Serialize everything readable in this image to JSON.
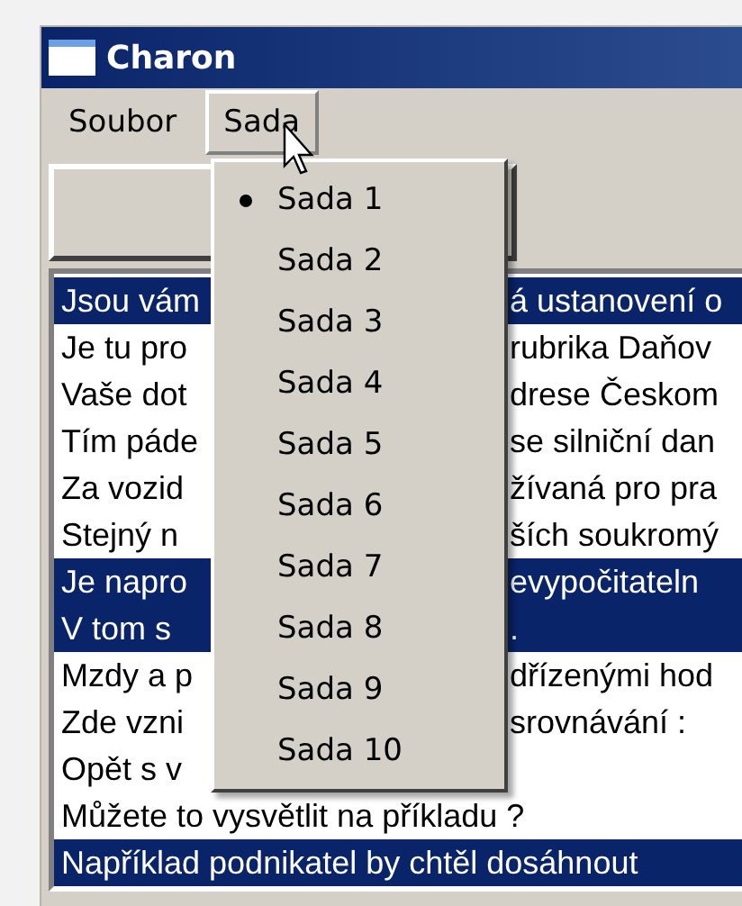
{
  "window": {
    "title": "Charon"
  },
  "menu_bar": [
    {
      "label": "Soubor",
      "selected": false
    },
    {
      "label": "Sada",
      "selected": true
    }
  ],
  "dropdown": [
    {
      "label": "Sada 1",
      "checked": true
    },
    {
      "label": "Sada 2",
      "checked": false
    },
    {
      "label": "Sada 3",
      "checked": false
    },
    {
      "label": "Sada 4",
      "checked": false
    },
    {
      "label": "Sada 5",
      "checked": false
    },
    {
      "label": "Sada 6",
      "checked": false
    },
    {
      "label": "Sada 7",
      "checked": false
    },
    {
      "label": "Sada 8",
      "checked": false
    },
    {
      "label": "Sada 9",
      "checked": false
    },
    {
      "label": "Sada 10",
      "checked": false
    }
  ],
  "list": [
    {
      "left": "Jsou vám",
      "right": "á ustanovení o",
      "selected": true
    },
    {
      "left": "Je tu pro",
      "right": "rubrika Daňov",
      "selected": false
    },
    {
      "left": "Vaše dot",
      "right": "drese Českom",
      "selected": false
    },
    {
      "left": "Tím páde",
      "right": "se silniční dan",
      "selected": false
    },
    {
      "left": "Za vozid",
      "right": "žívaná pro pra",
      "selected": false
    },
    {
      "left": "Stejný n",
      "right": "ších soukromý",
      "selected": false
    },
    {
      "left": "Je napro",
      "right": "evypočitateln",
      "selected": true
    },
    {
      "left": "V tom s",
      "right": ".",
      "selected": true
    },
    {
      "left": "Mzdy a p",
      "right": "dřízenými hod",
      "selected": false
    },
    {
      "left": "Zde vzni",
      "right": "srovnávání :",
      "selected": false
    },
    {
      "left": "Opět s v",
      "selected": false
    },
    {
      "left": "Můžete to vysvětlit na příkladu ?",
      "selected": false
    },
    {
      "left": "Například podnikatel by chtěl dosáhnout",
      "selected": true
    }
  ]
}
